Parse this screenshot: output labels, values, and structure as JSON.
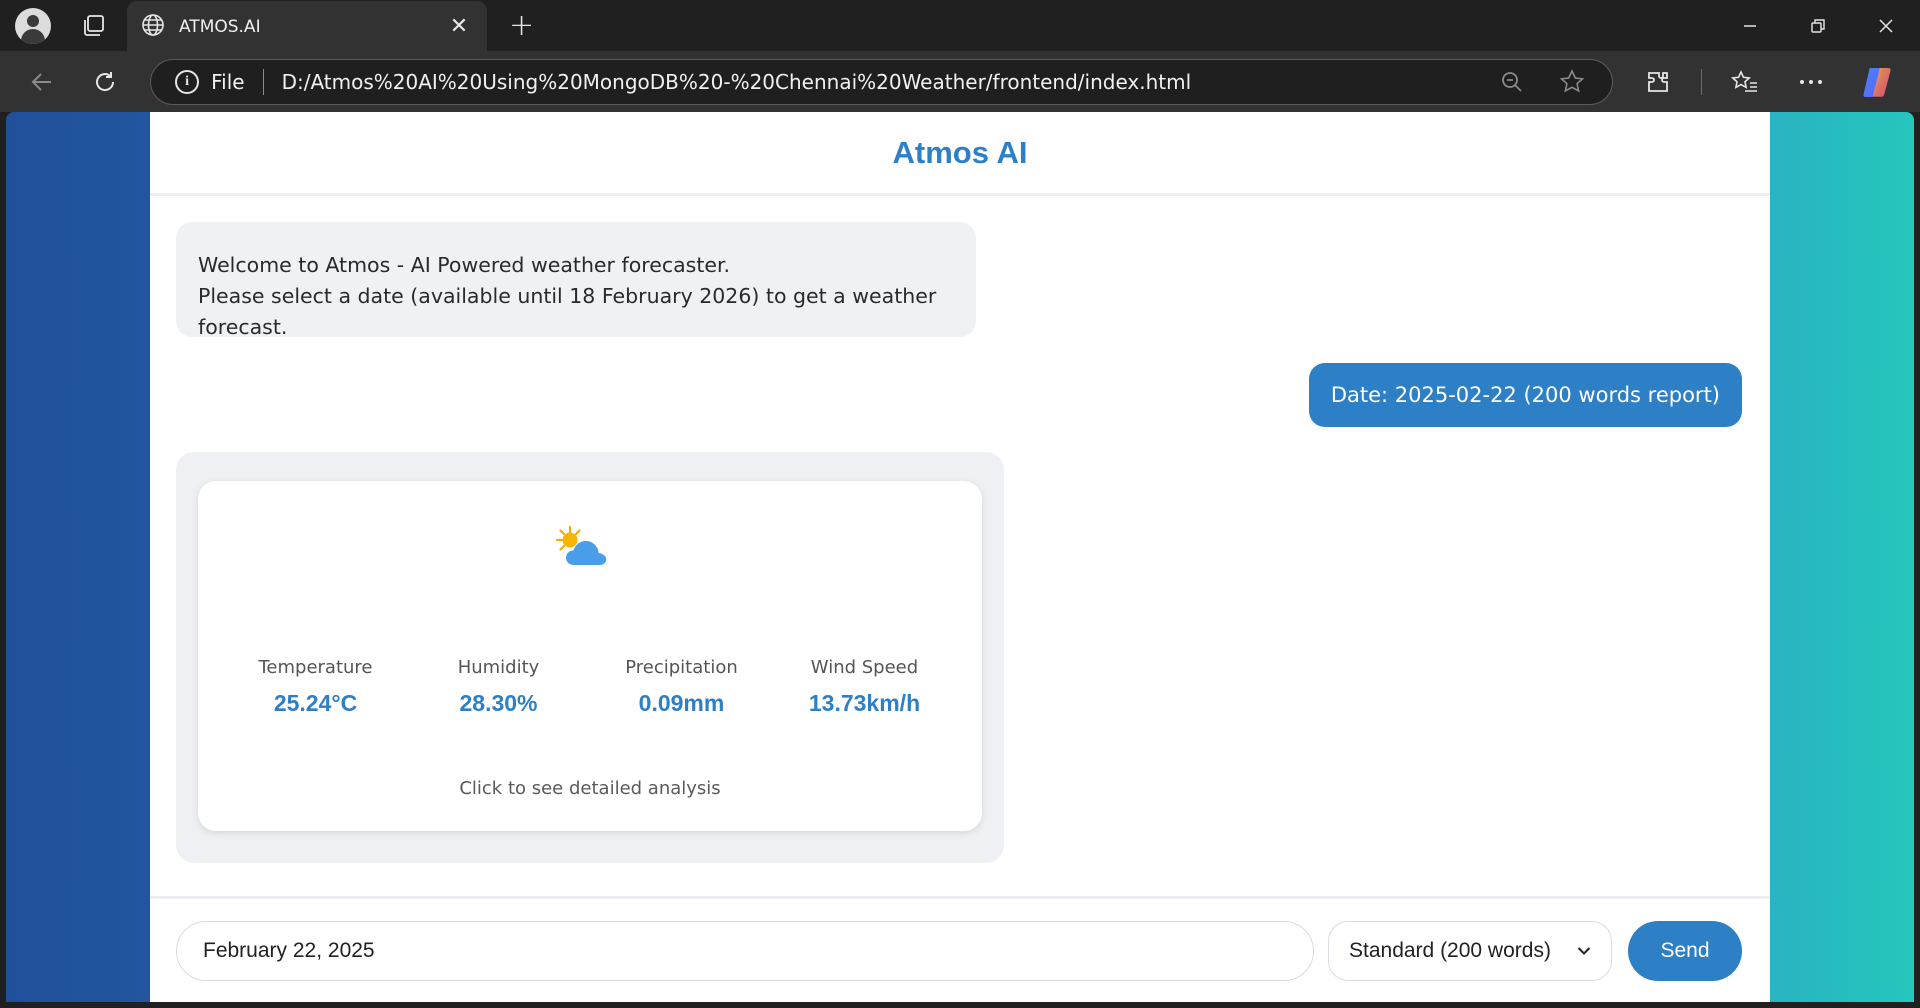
{
  "browser": {
    "tab_title": "ATMOS.AI",
    "tab_close": "✕",
    "new_tab": "+",
    "address_scheme": "File",
    "url": "D:/Atmos%20AI%20Using%20MongoDB%20-%20Chennai%20Weather/frontend/index.html"
  },
  "app": {
    "title": "Atmos AI"
  },
  "chat": {
    "bot_message_line1": "Welcome to Atmos - AI Powered weather forecaster.",
    "bot_message_line2": "Please select a date (available until 18 February 2026) to get a weather forecast.",
    "user_message": "Date: 2025-02-22 (200 words report)",
    "weather": {
      "icon": "partly-sunny-icon",
      "metrics": [
        {
          "label": "Temperature",
          "value": "25.24°C"
        },
        {
          "label": "Humidity",
          "value": "28.30%"
        },
        {
          "label": "Precipitation",
          "value": "0.09mm"
        },
        {
          "label": "Wind Speed",
          "value": "13.73km/h"
        }
      ],
      "detail_text": "Click to see detailed analysis"
    }
  },
  "input": {
    "date_value": "February 22, 2025",
    "length_selected": "Standard (200 words)",
    "send_label": "Send"
  },
  "colors": {
    "accent": "#2d7fc6",
    "bubble_bg": "#f0f1f4",
    "gradient_start": "#21509b",
    "gradient_end": "#26c6bd"
  }
}
